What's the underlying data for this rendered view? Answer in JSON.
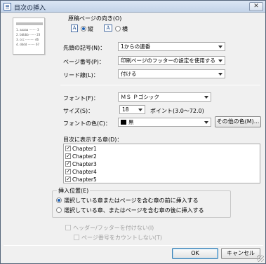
{
  "window": {
    "title": "目次の挿入",
    "close_glyph": "✕"
  },
  "preview": {
    "lines": [
      "1. aaaaa ········ 3",
      "2. bbbbb ······· 23",
      "3. ccc ·········· 46",
      "4. dddd ········ 67"
    ]
  },
  "orientation": {
    "label": "原稿ページの向き(O)",
    "portrait_label": "縦",
    "landscape_label": "横",
    "selected": "portrait",
    "icon_glyph": "A"
  },
  "fields": {
    "leading_symbol": {
      "label": "先頭の記号(N)：",
      "value": "1からの連番"
    },
    "page_number": {
      "label": "ページ番号(P)：",
      "value": "印刷ページのフッターの設定を使用する"
    },
    "leader": {
      "label": "リード線(L)：",
      "value": "付ける"
    },
    "font": {
      "label": "フォント(F)：",
      "value": "ＭＳ Ｐゴシック"
    },
    "size": {
      "label": "サイズ(S)：",
      "value": "18",
      "unit_hint": "ポイント(3.0〜72.0)"
    },
    "font_color": {
      "label": "フォントの色(C)：",
      "value": "黒",
      "swatch_color": "#000000",
      "more_button": "その他の色(M)..."
    }
  },
  "chapters": {
    "label": "目次に表示する章(D)：",
    "items": [
      {
        "label": "Chapter1",
        "checked": true
      },
      {
        "label": "Chapter2",
        "checked": true
      },
      {
        "label": "Chapter3",
        "checked": true
      },
      {
        "label": "Chapter4",
        "checked": true
      },
      {
        "label": "Chapter5",
        "checked": true
      }
    ]
  },
  "insert_position": {
    "label": "挿入位置(E)",
    "option_before": "選択している章またはページを含む章の前に挿入する",
    "option_after": "選択している章、またはページを含む章の後に挿入する",
    "selected": "before"
  },
  "header_footer": {
    "no_header_footer": "ヘッダー/フッターを付けない(I)",
    "no_count_pages": "ページ番号をカウントしない(T)"
  },
  "buttons": {
    "ok": "OK",
    "cancel": "キャンセル"
  }
}
